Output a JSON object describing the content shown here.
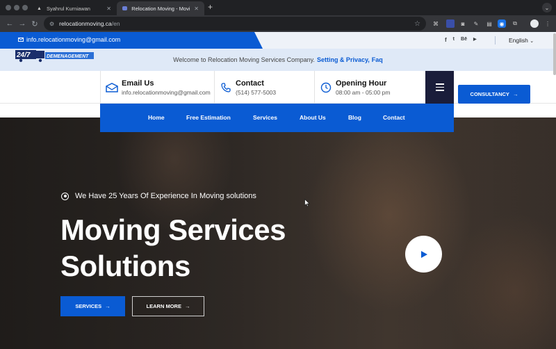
{
  "browser": {
    "tabs": [
      {
        "label": "Syahrul Kurniawan",
        "active": false
      },
      {
        "label": "Relocation Moving - Moving Se",
        "active": true
      }
    ],
    "new_tab_label": "+",
    "url_host": "relocationmoving.ca",
    "url_path": "/en"
  },
  "topbar": {
    "email": "info.relocationmoving@gmail.com",
    "socials": [
      "f",
      "t",
      "Bē",
      "▶"
    ],
    "language": "English"
  },
  "welcome": {
    "text": "Welcome to Relocation Moving Services Company.",
    "link1": "Setting & Privacy,",
    "link2": "Faq"
  },
  "logo": {
    "number": "24/7",
    "word": "DEMENAGEMENT"
  },
  "header": {
    "email_title": "Email Us",
    "email_value": "info.relocationmoving@gmail.com",
    "contact_title": "Contact",
    "contact_value": "(514) 577-5003",
    "hours_title": "Opening Hour",
    "hours_value": "08:00 am - 05:00 pm",
    "consultancy_label": "CONSULTANCY"
  },
  "nav": [
    "Home",
    "Free Estimation",
    "Services",
    "About Us",
    "Blog",
    "Contact"
  ],
  "hero": {
    "experience": "We Have 25 Years Of Experience In Moving solutions",
    "headline_line1": "Moving Services",
    "headline_line2": "Solutions",
    "services_label": "SERVICES",
    "learn_label": "LEARN MORE"
  },
  "colors": {
    "brand_blue": "#0a5bd3",
    "navy": "#1a1d3a",
    "welcome_bg": "#dfe9f7"
  }
}
